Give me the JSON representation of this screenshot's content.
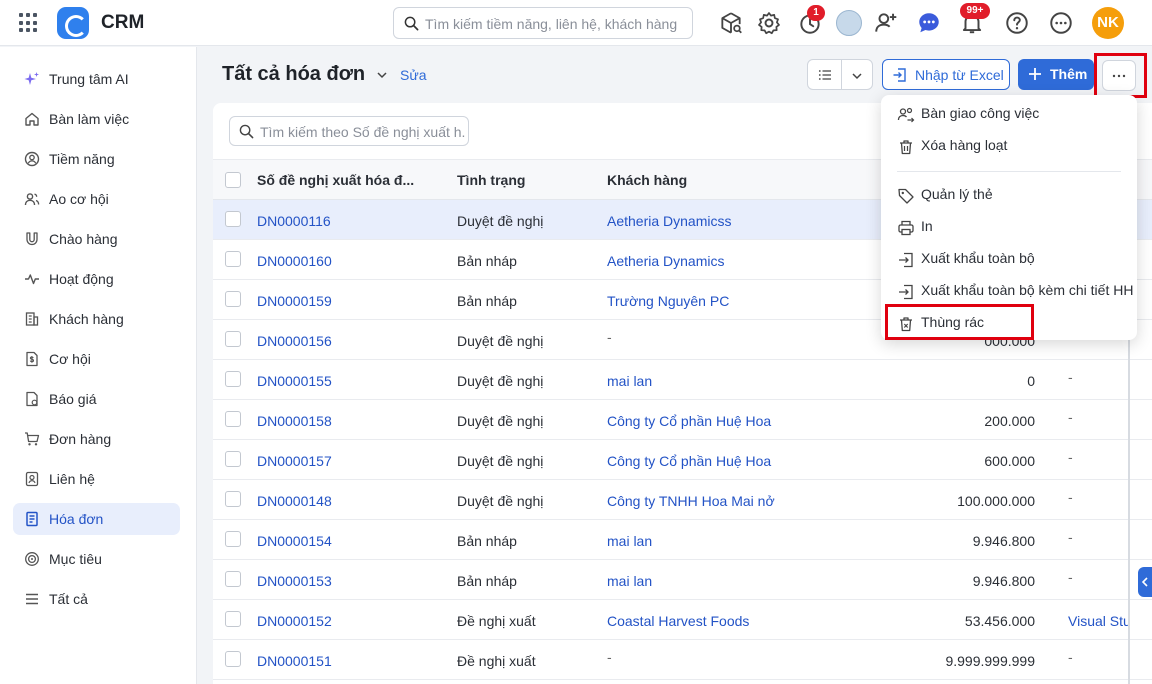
{
  "app": {
    "name": "CRM",
    "search_placeholder": "Tìm kiếm tiềm năng, liên hệ, khách hàng",
    "timer_badge": "1",
    "notif_badge": "99+",
    "user_initials": "NK"
  },
  "sidebar": {
    "items": [
      {
        "label": "Trung tâm AI",
        "icon": "sparkle-icon"
      },
      {
        "label": "Bàn làm việc",
        "icon": "home-icon"
      },
      {
        "label": "Tiềm năng",
        "icon": "user-circle-icon"
      },
      {
        "label": "Ao cơ hội",
        "icon": "users-icon"
      },
      {
        "label": "Chào hàng",
        "icon": "magnet-icon"
      },
      {
        "label": "Hoạt động",
        "icon": "activity-icon"
      },
      {
        "label": "Khách hàng",
        "icon": "building-icon"
      },
      {
        "label": "Cơ hội",
        "icon": "dollar-doc-icon"
      },
      {
        "label": "Báo giá",
        "icon": "quote-doc-icon"
      },
      {
        "label": "Đơn hàng",
        "icon": "cart-icon"
      },
      {
        "label": "Liên hệ",
        "icon": "contact-icon"
      },
      {
        "label": "Hóa đơn",
        "icon": "invoice-icon",
        "active": true
      },
      {
        "label": "Mục tiêu",
        "icon": "target-icon"
      },
      {
        "label": "Tất cả",
        "icon": "menu-icon"
      }
    ]
  },
  "main": {
    "title": "Tất cả hóa đơn",
    "edit_label": "Sửa",
    "import_label": "Nhập từ Excel",
    "add_label": "Thêm",
    "list_search_placeholder": "Tìm kiếm theo Số đề nghị xuất h...",
    "columns": [
      "Số đề nghị xuất hóa đ...",
      "Tình trạng",
      "Khách hàng"
    ],
    "rows": [
      {
        "id": "DN0000116",
        "status": "Duyệt đề nghị",
        "customer": "Aetheria Dynamicss",
        "amount": "",
        "extra": "",
        "selected": true
      },
      {
        "id": "DN0000160",
        "status": "Bản nháp",
        "customer": "Aetheria Dynamics",
        "amount": "",
        "extra": ""
      },
      {
        "id": "DN0000159",
        "status": "Bản nháp",
        "customer": "Trường Nguyên PC",
        "amount": "",
        "extra": ""
      },
      {
        "id": "DN0000156",
        "status": "Duyệt đề nghị",
        "customer": "-",
        "amount": "000.000",
        "extra": ""
      },
      {
        "id": "DN0000155",
        "status": "Duyệt đề nghị",
        "customer": "mai lan",
        "amount": "0",
        "extra": "-"
      },
      {
        "id": "DN0000158",
        "status": "Duyệt đề nghị",
        "customer": "Công ty Cổ phần Huệ Hoa",
        "amount": "200.000",
        "extra": "-"
      },
      {
        "id": "DN0000157",
        "status": "Duyệt đề nghị",
        "customer": "Công ty Cổ phần Huệ Hoa",
        "amount": "600.000",
        "extra": "-"
      },
      {
        "id": "DN0000148",
        "status": "Duyệt đề nghị",
        "customer": "Công ty TNHH Hoa Mai nở",
        "amount": "100.000.000",
        "extra": "-"
      },
      {
        "id": "DN0000154",
        "status": "Bản nháp",
        "customer": "mai lan",
        "amount": "9.946.800",
        "extra": "-"
      },
      {
        "id": "DN0000153",
        "status": "Bản nháp",
        "customer": "mai lan",
        "amount": "9.946.800",
        "extra": "-"
      },
      {
        "id": "DN0000152",
        "status": "Đề nghị xuất",
        "customer": "Coastal Harvest Foods",
        "amount": "53.456.000",
        "extra": "Visual Stu"
      },
      {
        "id": "DN0000151",
        "status": "Đề nghị xuất",
        "customer": "-",
        "amount": "9.999.999.999",
        "extra": "-"
      }
    ]
  },
  "menu": {
    "items": [
      {
        "label": "Bàn giao công việc",
        "icon": "handover-icon"
      },
      {
        "label": "Xóa hàng loạt",
        "icon": "trash-icon"
      },
      {
        "label": "Quản lý thẻ",
        "icon": "tag-icon"
      },
      {
        "label": "In",
        "icon": "printer-icon"
      },
      {
        "label": "Xuất khẩu toàn bộ",
        "icon": "export-icon"
      },
      {
        "label": "Xuất khẩu toàn bộ kèm chi tiết HH",
        "icon": "export-detail-icon"
      },
      {
        "label": "Thùng rác",
        "icon": "trash-bin-icon"
      }
    ]
  },
  "colors": {
    "accent": "#2f6bd8",
    "highlight": "#e0000f",
    "active_bg": "#e8eefc",
    "avatar": "#f59e0b"
  }
}
